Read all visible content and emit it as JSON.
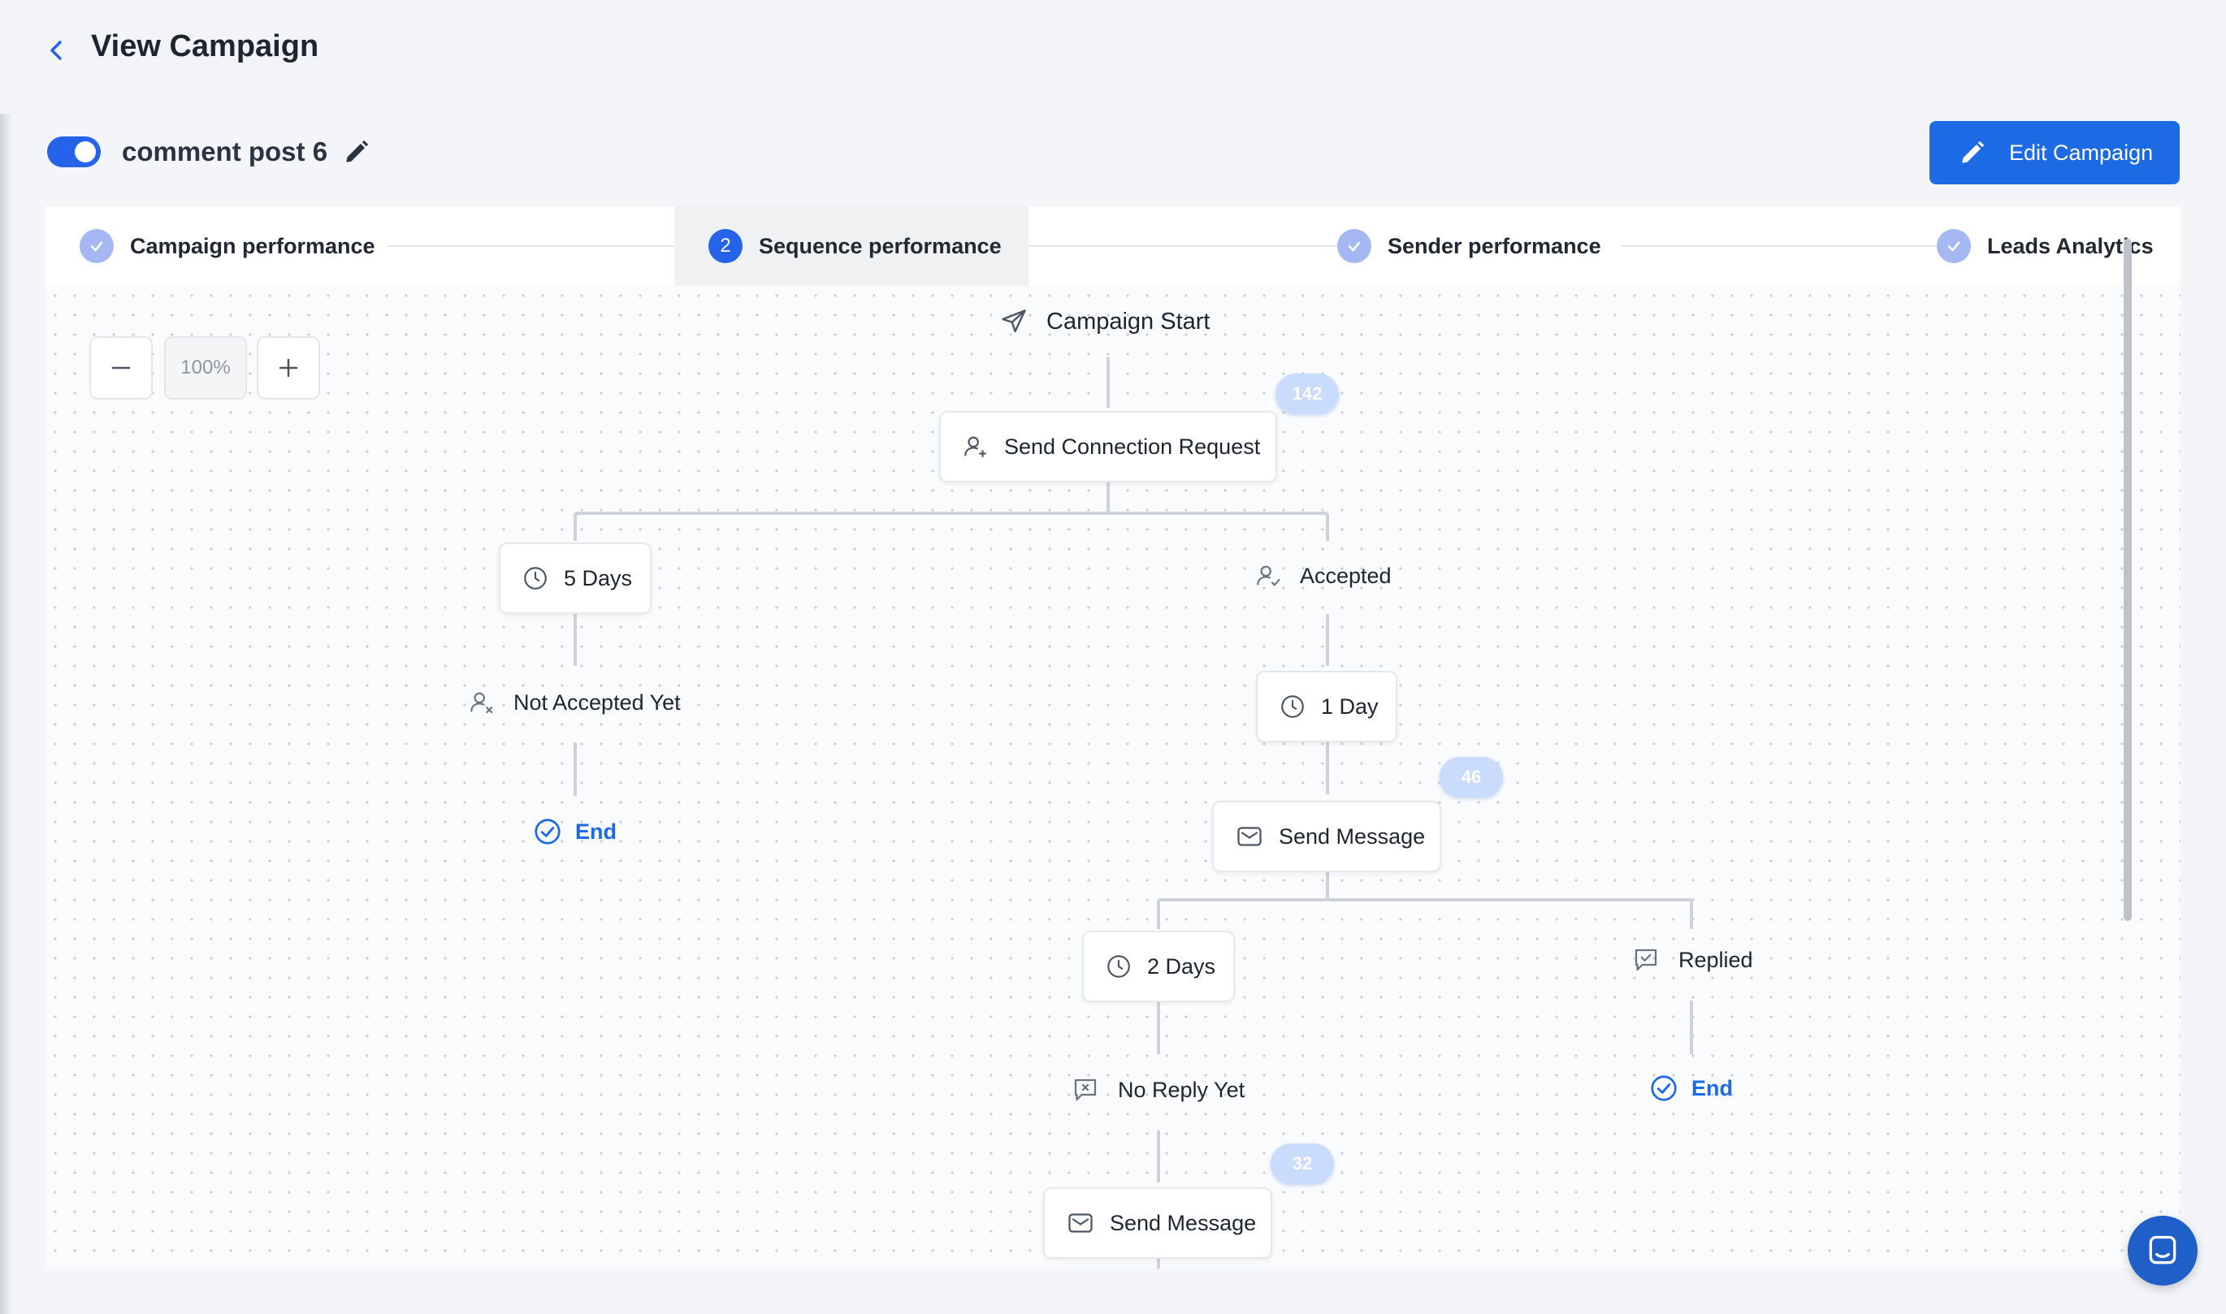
{
  "header": {
    "title": "View Campaign"
  },
  "campaign": {
    "name": "comment post 6",
    "active": true
  },
  "toolbar": {
    "edit_label": "Edit Campaign"
  },
  "tabs": [
    {
      "label": "Campaign performance",
      "status": "done"
    },
    {
      "label": "Sequence performance",
      "status": "active",
      "number": "2"
    },
    {
      "label": "Sender performance",
      "status": "done"
    },
    {
      "label": "Leads Analytics",
      "status": "done"
    }
  ],
  "zoom": {
    "level": "100%"
  },
  "flow": {
    "start": "Campaign Start",
    "send_connection_request": "Send Connection Request",
    "count_connection": "142",
    "wait_5_days": "5 Days",
    "accepted": "Accepted",
    "not_accepted": "Not Accepted Yet",
    "end_left": "End",
    "wait_1_day": "1 Day",
    "count_message_1": "46",
    "send_message_1": "Send Message",
    "wait_2_days": "2 Days",
    "replied": "Replied",
    "end_right": "End",
    "no_reply": "No Reply Yet",
    "count_message_2": "32",
    "send_message_2": "Send Message"
  },
  "colors": {
    "accent": "#1d6ae5",
    "connector": "#cfd3d9",
    "count_badge": "#c9dcfb"
  }
}
